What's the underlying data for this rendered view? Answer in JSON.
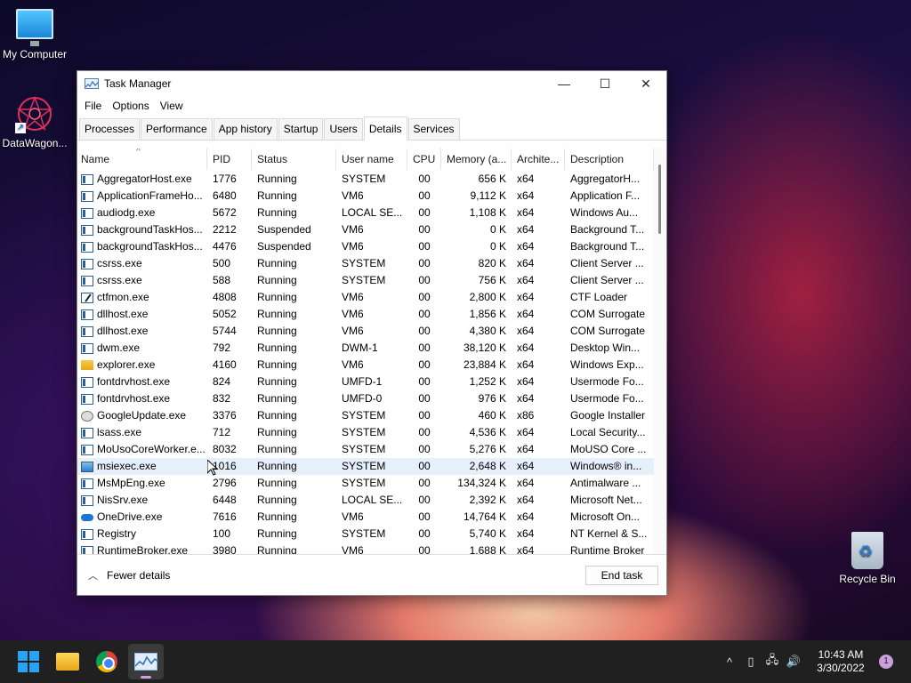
{
  "desktop": {
    "icons": [
      {
        "label": "My Computer"
      },
      {
        "label": "DataWagon..."
      },
      {
        "label": "Recycle Bin"
      }
    ]
  },
  "window": {
    "title": "Task Manager",
    "controls": {
      "minimize": "—",
      "maximize": "☐",
      "close": "✕"
    }
  },
  "menu": [
    "File",
    "Options",
    "View"
  ],
  "tabs": [
    "Processes",
    "Performance",
    "App history",
    "Startup",
    "Users",
    "Details",
    "Services"
  ],
  "active_tab": "Details",
  "columns": [
    "Name",
    "PID",
    "Status",
    "User name",
    "CPU",
    "Memory (a...",
    "Archite...",
    "Description"
  ],
  "rows": [
    {
      "name": "AggregatorHost.exe",
      "pid": "1776",
      "status": "Running",
      "user": "SYSTEM",
      "cpu": "00",
      "mem": "656 K",
      "arch": "x64",
      "desc": "AggregatorH...",
      "icon": "generic"
    },
    {
      "name": "ApplicationFrameHo...",
      "pid": "6480",
      "status": "Running",
      "user": "VM6",
      "cpu": "00",
      "mem": "9,112 K",
      "arch": "x64",
      "desc": "Application F...",
      "icon": "generic"
    },
    {
      "name": "audiodg.exe",
      "pid": "5672",
      "status": "Running",
      "user": "LOCAL SE...",
      "cpu": "00",
      "mem": "1,108 K",
      "arch": "x64",
      "desc": "Windows Au...",
      "icon": "generic"
    },
    {
      "name": "backgroundTaskHos...",
      "pid": "2212",
      "status": "Suspended",
      "user": "VM6",
      "cpu": "00",
      "mem": "0 K",
      "arch": "x64",
      "desc": "Background T...",
      "icon": "generic"
    },
    {
      "name": "backgroundTaskHos...",
      "pid": "4476",
      "status": "Suspended",
      "user": "VM6",
      "cpu": "00",
      "mem": "0 K",
      "arch": "x64",
      "desc": "Background T...",
      "icon": "generic"
    },
    {
      "name": "csrss.exe",
      "pid": "500",
      "status": "Running",
      "user": "SYSTEM",
      "cpu": "00",
      "mem": "820 K",
      "arch": "x64",
      "desc": "Client Server ...",
      "icon": "generic"
    },
    {
      "name": "csrss.exe",
      "pid": "588",
      "status": "Running",
      "user": "SYSTEM",
      "cpu": "00",
      "mem": "756 K",
      "arch": "x64",
      "desc": "Client Server ...",
      "icon": "generic"
    },
    {
      "name": "ctfmon.exe",
      "pid": "4808",
      "status": "Running",
      "user": "VM6",
      "cpu": "00",
      "mem": "2,800 K",
      "arch": "x64",
      "desc": "CTF Loader",
      "icon": "pen"
    },
    {
      "name": "dllhost.exe",
      "pid": "5052",
      "status": "Running",
      "user": "VM6",
      "cpu": "00",
      "mem": "1,856 K",
      "arch": "x64",
      "desc": "COM Surrogate",
      "icon": "generic"
    },
    {
      "name": "dllhost.exe",
      "pid": "5744",
      "status": "Running",
      "user": "VM6",
      "cpu": "00",
      "mem": "4,380 K",
      "arch": "x64",
      "desc": "COM Surrogate",
      "icon": "generic"
    },
    {
      "name": "dwm.exe",
      "pid": "792",
      "status": "Running",
      "user": "DWM-1",
      "cpu": "00",
      "mem": "38,120 K",
      "arch": "x64",
      "desc": "Desktop Win...",
      "icon": "generic"
    },
    {
      "name": "explorer.exe",
      "pid": "4160",
      "status": "Running",
      "user": "VM6",
      "cpu": "00",
      "mem": "23,884 K",
      "arch": "x64",
      "desc": "Windows Exp...",
      "icon": "folder"
    },
    {
      "name": "fontdrvhost.exe",
      "pid": "824",
      "status": "Running",
      "user": "UMFD-1",
      "cpu": "00",
      "mem": "1,252 K",
      "arch": "x64",
      "desc": "Usermode Fo...",
      "icon": "generic"
    },
    {
      "name": "fontdrvhost.exe",
      "pid": "832",
      "status": "Running",
      "user": "UMFD-0",
      "cpu": "00",
      "mem": "976 K",
      "arch": "x64",
      "desc": "Usermode Fo...",
      "icon": "generic"
    },
    {
      "name": "GoogleUpdate.exe",
      "pid": "3376",
      "status": "Running",
      "user": "SYSTEM",
      "cpu": "00",
      "mem": "460 K",
      "arch": "x86",
      "desc": "Google Installer",
      "icon": "gear"
    },
    {
      "name": "lsass.exe",
      "pid": "712",
      "status": "Running",
      "user": "SYSTEM",
      "cpu": "00",
      "mem": "4,536 K",
      "arch": "x64",
      "desc": "Local Security...",
      "icon": "generic"
    },
    {
      "name": "MoUsoCoreWorker.e...",
      "pid": "8032",
      "status": "Running",
      "user": "SYSTEM",
      "cpu": "00",
      "mem": "5,276 K",
      "arch": "x64",
      "desc": "MoUSO Core ...",
      "icon": "generic"
    },
    {
      "name": "msiexec.exe",
      "pid": "1016",
      "status": "Running",
      "user": "SYSTEM",
      "cpu": "00",
      "mem": "2,648 K",
      "arch": "x64",
      "desc": "Windows® in...",
      "icon": "msi"
    },
    {
      "name": "MsMpEng.exe",
      "pid": "2796",
      "status": "Running",
      "user": "SYSTEM",
      "cpu": "00",
      "mem": "134,324 K",
      "arch": "x64",
      "desc": "Antimalware ...",
      "icon": "generic"
    },
    {
      "name": "NisSrv.exe",
      "pid": "6448",
      "status": "Running",
      "user": "LOCAL SE...",
      "cpu": "00",
      "mem": "2,392 K",
      "arch": "x64",
      "desc": "Microsoft Net...",
      "icon": "generic"
    },
    {
      "name": "OneDrive.exe",
      "pid": "7616",
      "status": "Running",
      "user": "VM6",
      "cpu": "00",
      "mem": "14,764 K",
      "arch": "x64",
      "desc": "Microsoft On...",
      "icon": "cloud"
    },
    {
      "name": "Registry",
      "pid": "100",
      "status": "Running",
      "user": "SYSTEM",
      "cpu": "00",
      "mem": "5,740 K",
      "arch": "x64",
      "desc": "NT Kernel & S...",
      "icon": "generic"
    },
    {
      "name": "RuntimeBroker.exe",
      "pid": "3980",
      "status": "Running",
      "user": "VM6",
      "cpu": "00",
      "mem": "1,688 K",
      "arch": "x64",
      "desc": "Runtime Broker",
      "icon": "generic"
    }
  ],
  "hover_row": 17,
  "footer": {
    "fewer_details": "Fewer details",
    "end_task": "End task"
  },
  "taskbar": {
    "apps": [
      {
        "name": "start",
        "icon": "windows-logo-icon"
      },
      {
        "name": "file-explorer",
        "icon": "folder-icon"
      },
      {
        "name": "chrome",
        "icon": "chrome-icon"
      },
      {
        "name": "task-manager",
        "icon": "task-manager-icon"
      }
    ],
    "tray": {
      "chevron": "^",
      "time": "10:43 AM",
      "date": "3/30/2022",
      "notifications": "1"
    }
  },
  "colors": {
    "accent": "#2aa3f3",
    "hover_row": "#e5f0fb",
    "taskbar": "#202020"
  }
}
